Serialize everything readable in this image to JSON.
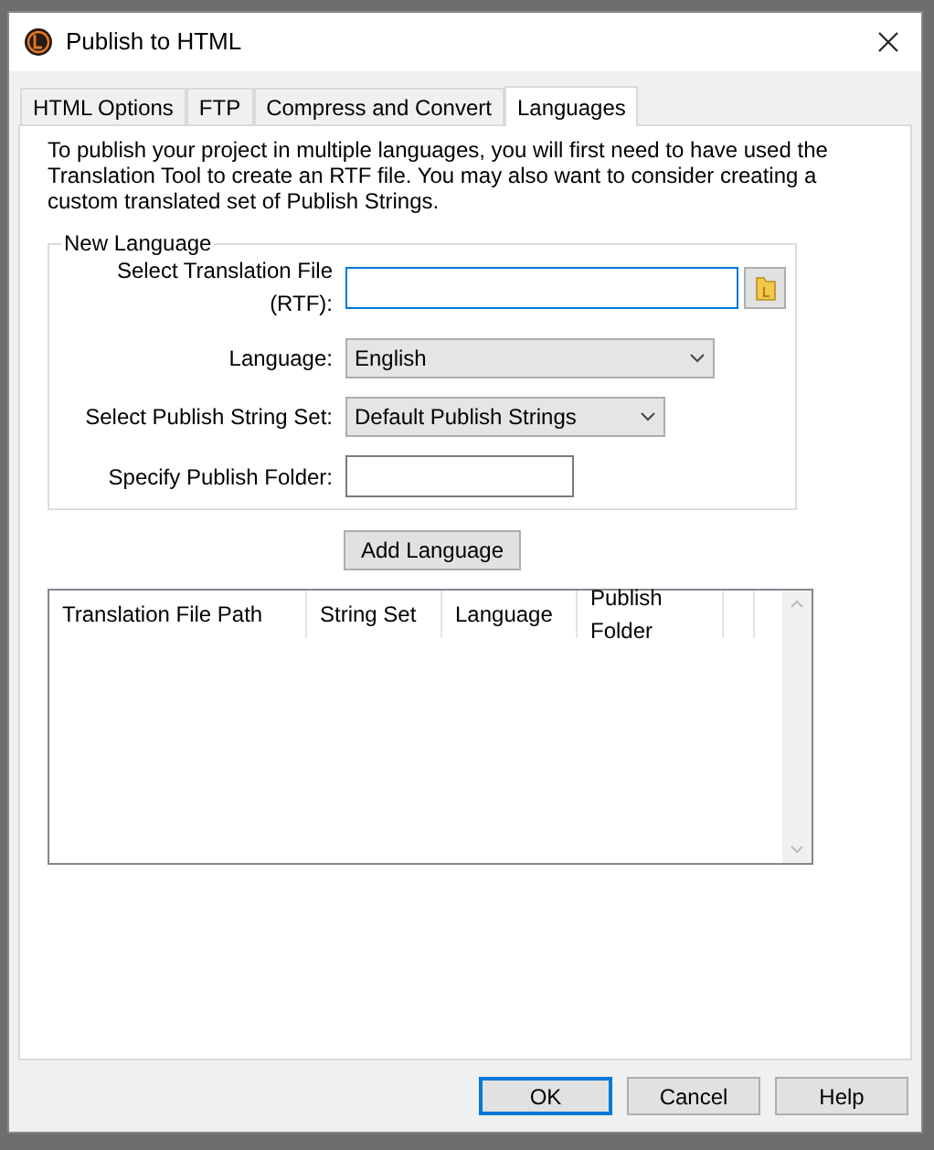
{
  "window": {
    "title": "Publish to HTML"
  },
  "tabs": [
    {
      "label": "HTML Options",
      "selected": false
    },
    {
      "label": "FTP",
      "selected": false
    },
    {
      "label": "Compress and Convert",
      "selected": false
    },
    {
      "label": "Languages",
      "selected": true
    }
  ],
  "intro": "To publish your project in multiple languages, you will first need to have used the Translation Tool to create an RTF file. You may also want to consider creating a custom translated set of Publish Strings.",
  "new_language": {
    "legend": "New Language",
    "fields": [
      {
        "kind": "file",
        "label": "Select Translation File (RTF):",
        "focused": true
      },
      {
        "kind": "select",
        "label": "Language:",
        "value": "English"
      },
      {
        "kind": "select",
        "label": "Select Publish String Set:",
        "value": "Default Publish Strings"
      },
      {
        "kind": "text",
        "label": "Specify Publish Folder:",
        "focused": false
      }
    ]
  },
  "add_button": "Add Language",
  "table": {
    "columns": [
      "Translation File Path",
      "String Set",
      "Language",
      "Publish Folder"
    ]
  },
  "buttons": [
    {
      "label": "OK",
      "selected": true
    },
    {
      "label": "Cancel",
      "selected": false
    },
    {
      "label": "Help",
      "selected": false
    }
  ]
}
